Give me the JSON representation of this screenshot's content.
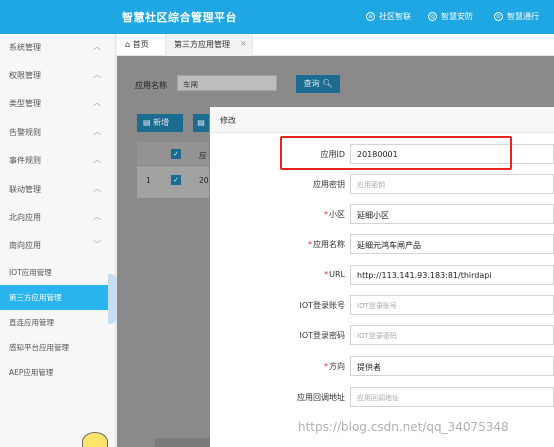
{
  "header": {
    "brand": "智慧社区综合管理平台",
    "nav": [
      {
        "label": "社区智联",
        "icon": "network-icon"
      },
      {
        "label": "智慧安防",
        "icon": "shield-icon"
      },
      {
        "label": "智慧通行",
        "icon": "pass-icon"
      }
    ]
  },
  "sidebar": {
    "menus": [
      {
        "label": "系统管理",
        "chevron": "^"
      },
      {
        "label": "权限管理",
        "chevron": "^"
      },
      {
        "label": "类型管理",
        "chevron": "^"
      },
      {
        "label": "告警规则",
        "chevron": "^"
      },
      {
        "label": "事件规则",
        "chevron": "^"
      },
      {
        "label": "联动管理",
        "chevron": "^"
      },
      {
        "label": "北向应用",
        "chevron": "^"
      },
      {
        "label": "南向应用",
        "chevron": "v"
      }
    ],
    "submenu": [
      {
        "label": "IOT应用管理"
      },
      {
        "label": "第三方应用管理"
      },
      {
        "label": "直连应用管理"
      },
      {
        "label": "感知平台应用管理"
      },
      {
        "label": "AEP应用管理"
      }
    ]
  },
  "tabs": {
    "home": "首页",
    "active": "第三方应用管理",
    "close": "×"
  },
  "query": {
    "label": "应用名称",
    "value": "车闸",
    "button": "查询"
  },
  "toolbar": {
    "add": "新增"
  },
  "table": {
    "row_number": "1",
    "partial_header": "应",
    "partial_cell": "20"
  },
  "modal": {
    "title": "修改",
    "fields": [
      {
        "label": "应用ID",
        "required": false,
        "value": "20180001",
        "placeholder": ""
      },
      {
        "label": "应用密钥",
        "required": false,
        "value": "",
        "placeholder": "应用密钥"
      },
      {
        "label": "小区",
        "required": true,
        "value": "延细小区",
        "placeholder": ""
      },
      {
        "label": "应用名称",
        "required": true,
        "value": "延细元鸿车闸产品",
        "placeholder": ""
      },
      {
        "label": "URL",
        "required": true,
        "value": "http://113.141.93.183:81/thirdapi",
        "placeholder": ""
      },
      {
        "label": "IOT登录账号",
        "required": false,
        "value": "",
        "placeholder": "IOT登录账号"
      },
      {
        "label": "IOT登录密码",
        "required": false,
        "value": "",
        "placeholder": "IOT登录密码"
      },
      {
        "label": "方向",
        "required": true,
        "value": "提供者",
        "placeholder": ""
      },
      {
        "label": "应用回调地址",
        "required": false,
        "value": "",
        "placeholder": "应用回调地址"
      }
    ]
  },
  "watermark": "https://blog.csdn.net/qq_34075348",
  "colors": {
    "primary": "#1fa7e3",
    "active_menu": "#2bb5ee",
    "button": "#1b6c90",
    "highlight": "#e8231f",
    "required": "#e62222"
  }
}
